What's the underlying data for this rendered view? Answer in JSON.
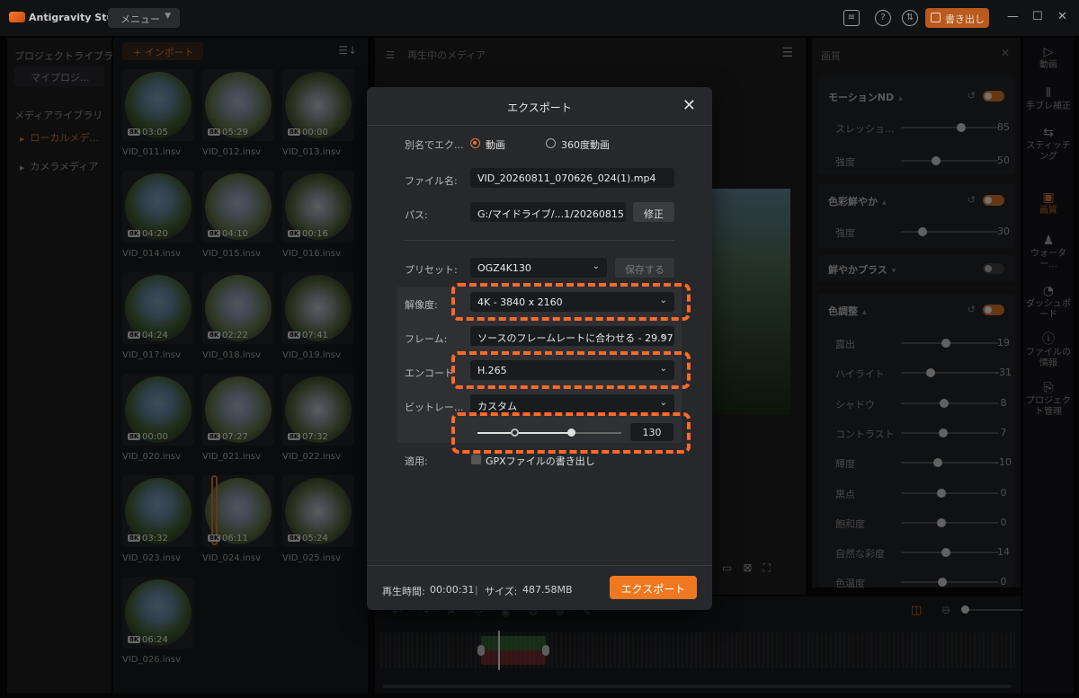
{
  "app": {
    "title": "Antigravity Studio",
    "menu_label": "メニュー",
    "writeback_label": "書き出し",
    "accent_color": "#e07a30"
  },
  "sidebar": {
    "title": "プロジェクトライブラリ",
    "my_project": "マイプロジ...",
    "media_library": "メディアライブラリ",
    "items": [
      {
        "label": "ローカルメデ...",
        "active": true
      },
      {
        "label": "カメラメディア",
        "active": false
      }
    ]
  },
  "media": {
    "import_label": "+ インポート",
    "sort_icon": "sort-icon",
    "badge": "8K",
    "clips": [
      {
        "name": "VID_011.insv",
        "duration": "03:05"
      },
      {
        "name": "VID_012.insv",
        "duration": "05:29"
      },
      {
        "name": "VID_013.insv",
        "duration": "00:00"
      },
      {
        "name": "VID_014.insv",
        "duration": "04:20"
      },
      {
        "name": "VID_015.insv",
        "duration": "04:10"
      },
      {
        "name": "VID_016.insv",
        "duration": "00:16"
      },
      {
        "name": "VID_017.insv",
        "duration": "04:24"
      },
      {
        "name": "VID_018.insv",
        "duration": "02:22"
      },
      {
        "name": "VID_019.insv",
        "duration": "07:41"
      },
      {
        "name": "VID_020.insv",
        "duration": "00:00"
      },
      {
        "name": "VID_021.insv",
        "duration": "07:27"
      },
      {
        "name": "VID_022.insv",
        "duration": "07:32"
      },
      {
        "name": "VID_023.insv",
        "duration": "03:32"
      },
      {
        "name": "VID_024.insv",
        "duration": "06:11"
      },
      {
        "name": "VID_025.insv",
        "duration": "05:24"
      },
      {
        "name": "VID_026.insv",
        "duration": "06:24"
      }
    ]
  },
  "player": {
    "header": "再生中のメディア"
  },
  "adjust": {
    "header": "画質",
    "sections": [
      {
        "title": "モーションND",
        "enabled": true,
        "rows": [
          {
            "label": "スレッショ...",
            "value": "85"
          },
          {
            "label": "強度",
            "value": "50"
          }
        ]
      },
      {
        "title": "色彩鮮やか",
        "enabled": true,
        "rows": [
          {
            "label": "強度",
            "value": "30"
          }
        ]
      },
      {
        "title": "鮮やかプラス",
        "enabled": false,
        "rows": []
      },
      {
        "title": "色調整",
        "enabled": true,
        "rows": [
          {
            "label": "露出",
            "value": "19"
          },
          {
            "label": "ハイライト",
            "value": "-31"
          },
          {
            "label": "シャドウ",
            "value": "8"
          },
          {
            "label": "コントラスト",
            "value": "7"
          },
          {
            "label": "輝度",
            "value": "-10"
          },
          {
            "label": "黒点",
            "value": "0"
          },
          {
            "label": "飽和度",
            "value": "0"
          },
          {
            "label": "自然な彩度",
            "value": "14"
          },
          {
            "label": "色温度",
            "value": "0"
          }
        ]
      }
    ]
  },
  "rnav": [
    {
      "label": "動画",
      "icon": "play-triangle-icon",
      "active": false
    },
    {
      "label": "手ブレ補正",
      "icon": "stabilize-icon",
      "active": false
    },
    {
      "label": "スティッチング",
      "icon": "stitch-icon",
      "active": false
    },
    {
      "label": "画質",
      "icon": "image-icon",
      "active": true
    },
    {
      "label": "ウォーター...",
      "icon": "watermark-icon",
      "active": false
    },
    {
      "label": "ダッシュボード",
      "icon": "dashboard-icon",
      "active": false
    },
    {
      "label": "ファイルの情報",
      "icon": "info-icon",
      "active": false
    },
    {
      "label": "プロジェクト管理",
      "icon": "project-icon",
      "active": false
    }
  ],
  "export_dialog": {
    "title": "エクスポート",
    "export_as_label": "別名でエク...",
    "mode_video": "動画",
    "mode_360": "360度動画",
    "filename_label": "ファイル名:",
    "filename_value": "VID_20260811_070626_024(1).mp4",
    "path_label": "パス:",
    "path_value": "G:/マイドライブ/...1/20260815",
    "path_edit": "修正",
    "preset_label": "プリセット:",
    "preset_value": "OGZ4K130",
    "preset_save": "保存する",
    "resolution_label": "解像度:",
    "resolution_value": "4K - 3840 x 2160",
    "frame_label": "フレーム:",
    "frame_value": "ソースのフレームレートに合わせる - 29.97",
    "encode_label": "エンコード",
    "encode_value": "H.265",
    "bitrate_label": "ビットレー...",
    "bitrate_value": "カスタム",
    "bitrate_number": "130",
    "apply_label": "適用:",
    "gpx_label": "GPXファイルの書き出し",
    "duration_label": "再生時間:",
    "duration_value": "00:00:31",
    "size_label": "サイズ:",
    "size_value": "487.58MB",
    "export_button": "エクスポート"
  }
}
